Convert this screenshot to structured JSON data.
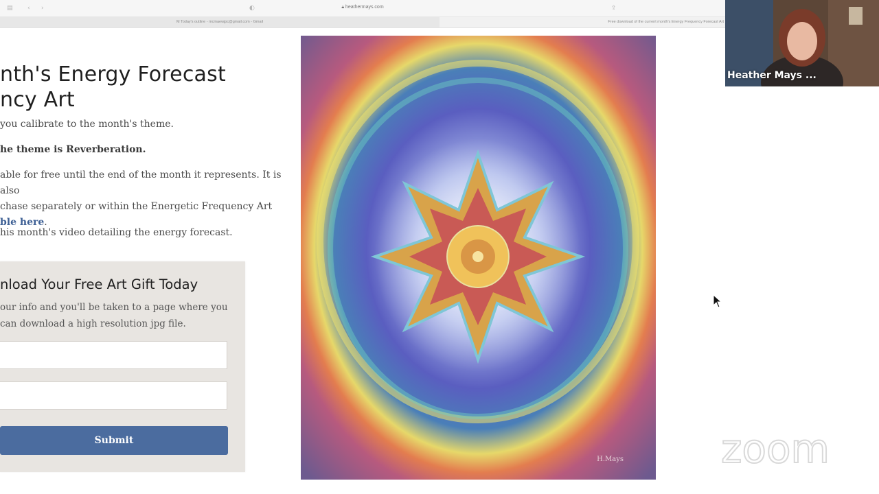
{
  "browser": {
    "url": "heathermays.com",
    "tab_gmail": "Today's outline - mcmaewjpc@gmail.com - Gmail",
    "tab_current": "Free download of the current month's Energy Frequency Forecast Art"
  },
  "page": {
    "title_line1": "nth's Energy Forecast",
    "title_line2": "ncy Art",
    "para1": "you calibrate to the month's theme.",
    "para2": "he theme is Reverberation.",
    "para3_line1": "able for free until the end of the month it represents.  It is also",
    "para3_line2": "chase separately or within the Energetic Frequency Art",
    "para3_link": "ble here",
    "para3_end": ".",
    "para4": "his month's video detailing the energy forecast."
  },
  "form": {
    "heading": "nload Your Free Art Gift Today",
    "desc_line1": "our info and you'll be taken to a page where you",
    "desc_line2": "can download a high resolution jpg file.",
    "name_value": "",
    "email_value": "",
    "submit_label": "Submit"
  },
  "artwork": {
    "signature": "H.Mays"
  },
  "video_call": {
    "participant_name": "Heather Mays ...",
    "app_logo": "zoom"
  },
  "icons": {
    "sidebar": "sidebar-icon",
    "back": "back-icon",
    "shield": "shield-icon",
    "lock": "lock-icon",
    "share": "share-icon",
    "cursor": "mouse-pointer-icon"
  }
}
